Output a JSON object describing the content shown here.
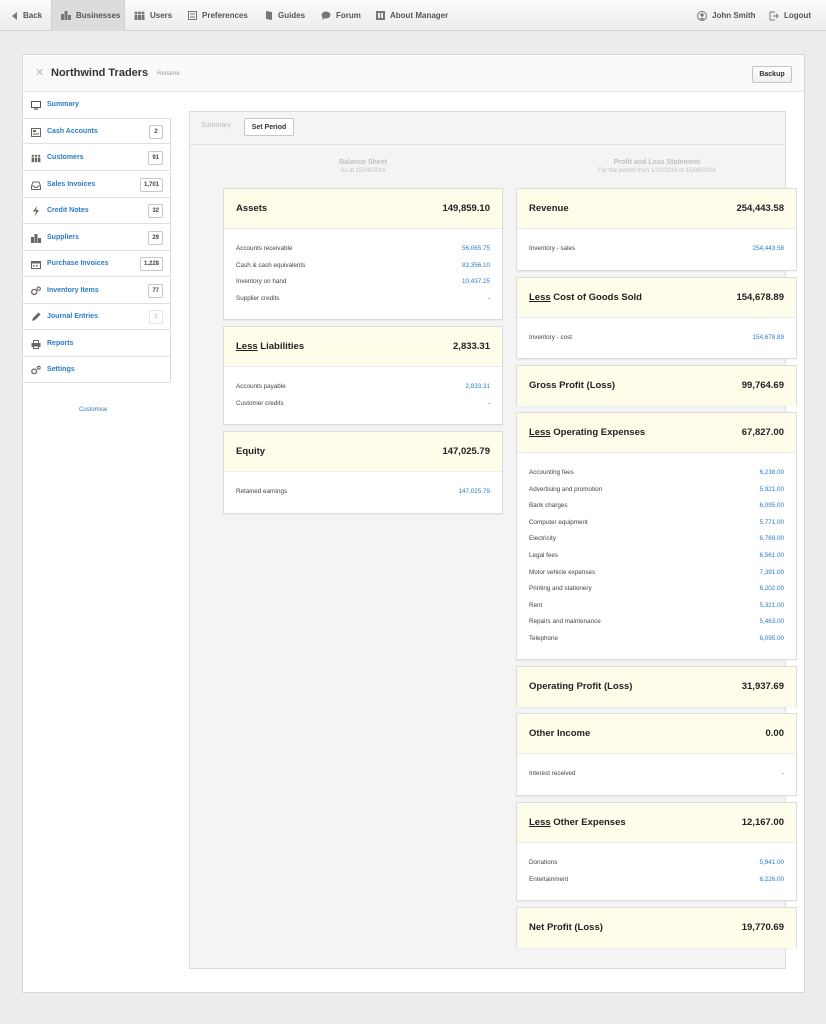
{
  "nav": {
    "back": "Back",
    "businesses": "Businesses",
    "users": "Users",
    "preferences": "Preferences",
    "guides": "Guides",
    "forum": "Forum",
    "about": "About Manager",
    "user": "John Smith",
    "logout": "Logout"
  },
  "header": {
    "business_name": "Northwind Traders",
    "rename": "Rename",
    "backup": "Backup"
  },
  "sidebar": {
    "items": [
      {
        "label": "Summary",
        "icon": "monitor-icon"
      },
      {
        "label": "Cash Accounts",
        "count": "2",
        "icon": "cash-icon"
      },
      {
        "label": "Customers",
        "count": "91",
        "icon": "customers-icon"
      },
      {
        "label": "Sales Invoices",
        "count": "1,701",
        "icon": "inbox-icon"
      },
      {
        "label": "Credit Notes",
        "count": "32",
        "icon": "lightning-icon"
      },
      {
        "label": "Suppliers",
        "count": "29",
        "icon": "building-icon"
      },
      {
        "label": "Purchase Invoices",
        "count": "1,228",
        "icon": "calendar-icon"
      },
      {
        "label": "Inventory Items",
        "count": "77",
        "icon": "gears-icon"
      },
      {
        "label": "Journal Entries",
        "count": "0",
        "icon": "pen-icon"
      },
      {
        "label": "Reports",
        "icon": "printer-icon"
      },
      {
        "label": "Settings",
        "icon": "settings-icon"
      }
    ],
    "customise": "Customise"
  },
  "content": {
    "tab_summary": "Summary",
    "set_period": "Set Period",
    "balance_sheet": {
      "title": "Balance Sheet",
      "subtitle": "As at 15/06/2016"
    },
    "pnl": {
      "title": "Profit and Loss Statement",
      "subtitle": "For the period from 1/01/2016 to 15/06/2016"
    },
    "less_word": "Less"
  },
  "balance": {
    "assets": {
      "title": "Assets",
      "total": "149,859.10",
      "rows": [
        {
          "name": "Accounts receivable",
          "value": "56,065.75"
        },
        {
          "name": "Cash & cash equivalents",
          "value": "83,356.10"
        },
        {
          "name": "Inventory on hand",
          "value": "10,437.25"
        },
        {
          "name": "Supplier credits",
          "value": "-"
        }
      ]
    },
    "liabilities": {
      "title": "Liabilities",
      "total": "2,833.31",
      "rows": [
        {
          "name": "Accounts payable",
          "value": "2,833.31"
        },
        {
          "name": "Customer credits",
          "value": "-"
        }
      ]
    },
    "equity": {
      "title": "Equity",
      "total": "147,025.79",
      "rows": [
        {
          "name": "Retained earnings",
          "value": "147,025.79"
        }
      ]
    }
  },
  "pl": {
    "revenue": {
      "title": "Revenue",
      "total": "254,443.58",
      "rows": [
        {
          "name": "Inventory - sales",
          "value": "254,443.58"
        }
      ]
    },
    "cogs": {
      "title": "Cost of Goods Sold",
      "total": "154,678.89",
      "rows": [
        {
          "name": "Inventory - cost",
          "value": "154,678.89"
        }
      ]
    },
    "gross": {
      "title": "Gross Profit (Loss)",
      "total": "99,764.69"
    },
    "opex": {
      "title": "Operating Expenses",
      "total": "67,827.00",
      "rows": [
        {
          "name": "Accounting fees",
          "value": "6,238.00"
        },
        {
          "name": "Advertising and promotion",
          "value": "5,921.00"
        },
        {
          "name": "Bank charges",
          "value": "6,095.00"
        },
        {
          "name": "Computer equipment",
          "value": "5,771.00"
        },
        {
          "name": "Electricity",
          "value": "6,769.00"
        },
        {
          "name": "Legal fees",
          "value": "6,561.00"
        },
        {
          "name": "Motor vehicle expenses",
          "value": "7,391.00"
        },
        {
          "name": "Printing and stationery",
          "value": "6,202.00"
        },
        {
          "name": "Rent",
          "value": "5,321.00"
        },
        {
          "name": "Repairs and maintenance",
          "value": "5,463.00"
        },
        {
          "name": "Telephone",
          "value": "6,095.00"
        }
      ]
    },
    "operating": {
      "title": "Operating Profit (Loss)",
      "total": "31,937.69"
    },
    "other_income": {
      "title": "Other Income",
      "total": "0.00",
      "rows": [
        {
          "name": "Interest received",
          "value": "-"
        }
      ]
    },
    "other_exp": {
      "title": "Other Expenses",
      "total": "12,167.00",
      "rows": [
        {
          "name": "Donations",
          "value": "5,941.00"
        },
        {
          "name": "Entertainment",
          "value": "6,226.00"
        }
      ]
    },
    "net": {
      "title": "Net Profit (Loss)",
      "total": "19,770.69"
    }
  },
  "colors": {
    "link": "#2a7cc7",
    "card_header": "#fdfdea"
  }
}
